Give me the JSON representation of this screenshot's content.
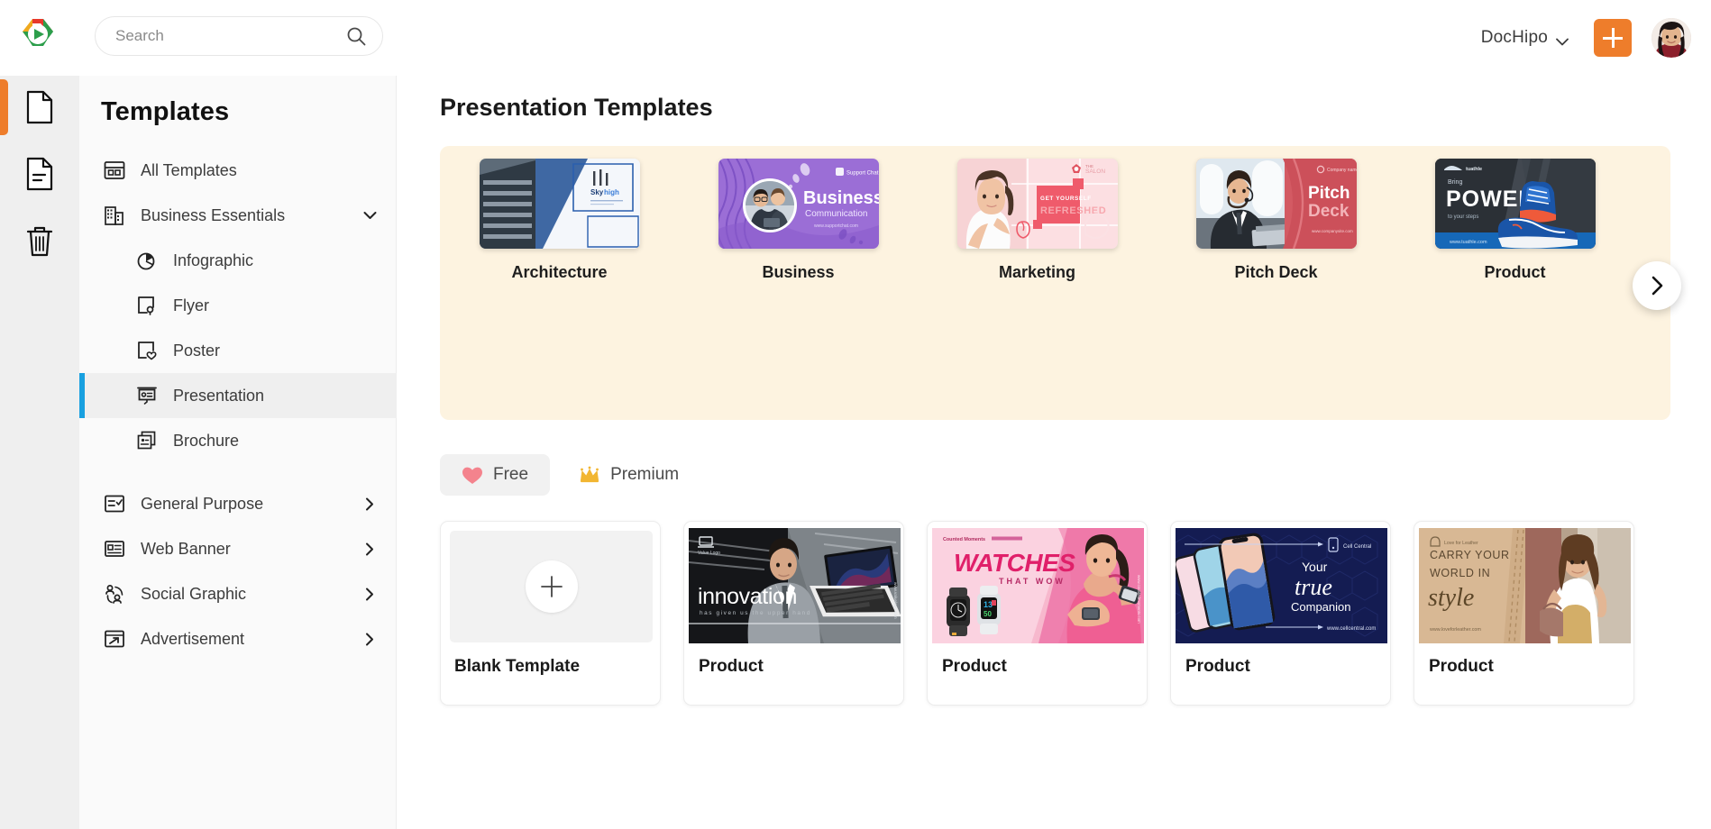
{
  "header": {
    "logo_name": "dochipo-logo",
    "search": {
      "placeholder": "Search",
      "value": ""
    },
    "workspace": "DocHipo",
    "add_label": "+",
    "avatar_alt": "User avatar"
  },
  "icon_rail": {
    "items": [
      {
        "name": "documents-icon",
        "label": "Documents",
        "active": true
      },
      {
        "name": "templates-doc-icon",
        "label": "My Designs",
        "active": false
      },
      {
        "name": "trash-icon",
        "label": "Trash",
        "active": false
      }
    ]
  },
  "sidebar": {
    "title": "Templates",
    "items": [
      {
        "label": "All Templates",
        "icon": "grid-icon",
        "level": 0,
        "caret": "none",
        "active": false
      },
      {
        "label": "Business Essentials",
        "icon": "building-icon",
        "level": 0,
        "caret": "down",
        "active": false
      },
      {
        "label": "Infographic",
        "icon": "piechart-icon",
        "level": 1,
        "caret": "none",
        "active": false
      },
      {
        "label": "Flyer",
        "icon": "flyer-icon",
        "level": 1,
        "caret": "none",
        "active": false
      },
      {
        "label": "Poster",
        "icon": "poster-heart-icon",
        "level": 1,
        "caret": "none",
        "active": false
      },
      {
        "label": "Presentation",
        "icon": "presentation-icon",
        "level": 1,
        "caret": "none",
        "active": true
      },
      {
        "label": "Brochure",
        "icon": "brochure-icon",
        "level": 1,
        "caret": "none",
        "active": false
      },
      {
        "label": "General Purpose",
        "icon": "checklist-icon",
        "level": 0,
        "caret": "right",
        "active": false
      },
      {
        "label": "Web Banner",
        "icon": "webbanner-icon",
        "level": 0,
        "caret": "right",
        "active": false
      },
      {
        "label": "Social Graphic",
        "icon": "social-icon",
        "level": 0,
        "caret": "right",
        "active": false
      },
      {
        "label": "Advertisement",
        "icon": "advertisement-icon",
        "level": 0,
        "caret": "right",
        "active": false
      }
    ]
  },
  "main": {
    "page_title": "Presentation Templates",
    "carousel": {
      "background_color": "#FDF3E0",
      "next_label": "›",
      "categories": [
        {
          "name": "Architecture",
          "art": "architecture"
        },
        {
          "name": "Business",
          "art": "business"
        },
        {
          "name": "Marketing",
          "art": "marketing"
        },
        {
          "name": "Pitch Deck",
          "art": "pitchdeck"
        },
        {
          "name": "Product",
          "art": "product-shoe"
        }
      ]
    },
    "filters": [
      {
        "label": "Free",
        "icon": "heart-icon",
        "active": true
      },
      {
        "label": "Premium",
        "icon": "crown-icon",
        "active": false
      }
    ],
    "cards": [
      {
        "label": "Blank Template",
        "art": "blank"
      },
      {
        "label": "Product",
        "art": "innovation"
      },
      {
        "label": "Product",
        "art": "watches"
      },
      {
        "label": "Product",
        "art": "phones"
      },
      {
        "label": "Product",
        "art": "leather"
      }
    ]
  },
  "colors": {
    "accent_orange": "#EE7D2B",
    "accent_blue": "#18A0E0",
    "carousel_bg": "#FDF3E0",
    "rail_bg": "#EFEFEF",
    "sidebar_bg": "#FAFAFA"
  }
}
